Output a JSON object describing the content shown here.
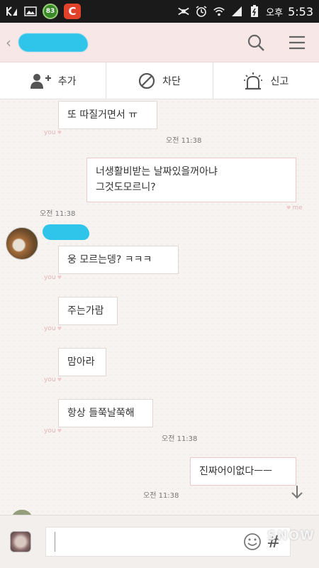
{
  "status_bar": {
    "badge_count": "83",
    "c_app_letter": "C",
    "ampm": "오후",
    "time": "5:53"
  },
  "header": {
    "back_symbol": "‹",
    "contact_name_redacted": ""
  },
  "actions": [
    {
      "icon": "add-friend-icon",
      "label": "추가"
    },
    {
      "icon": "block-icon",
      "label": "차단"
    },
    {
      "icon": "report-siren-icon",
      "label": "신고"
    }
  ],
  "messages": {
    "m1": "또 따질거면서 ㅠ",
    "m2_line1": "너생활비받는 날짜있을꺼아냐",
    "m2_line2": "그것도모르니?",
    "m3": "웅 모르는뎅? ㅋㅋㅋ",
    "m4": "주는가람",
    "m5": "맘아라",
    "m6": "항상 들쭉날쭉해",
    "m7": "진짜어이없다ㅡㅡ"
  },
  "tags": {
    "you": "you",
    "me": "me"
  },
  "times": {
    "t1": "오전 11:38",
    "t2": "오전 11:38",
    "t3": "오전 11:38",
    "t4": "오전 11:38"
  },
  "input": {
    "placeholder": "",
    "hash_symbol": "#"
  },
  "watermark": "SNOW",
  "colors": {
    "header_bg": "#f7e8e7",
    "chat_bg": "#f6f3f1",
    "redaction_blue": "#2fc5ea",
    "tag_pink": "#e4b4b7"
  }
}
